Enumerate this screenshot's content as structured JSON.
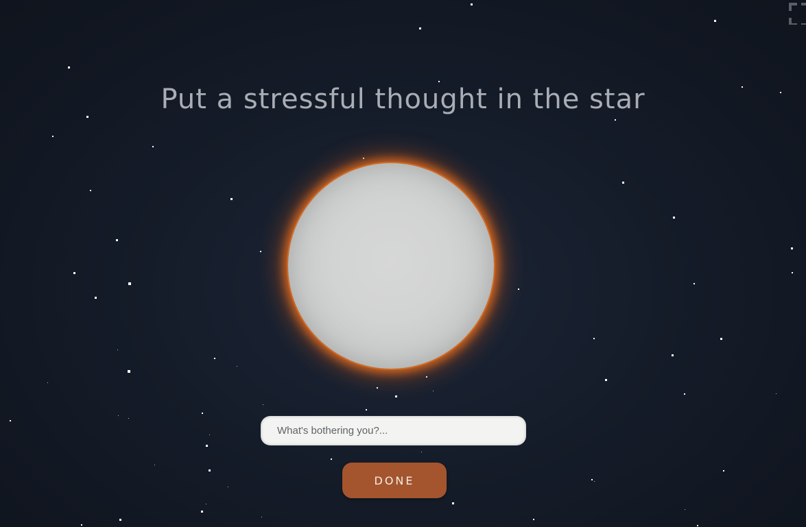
{
  "title": "Put a stressful thought in the star",
  "input": {
    "placeholder": "What's bothering you?..."
  },
  "button": {
    "label": "DONE"
  },
  "icons": {
    "fullscreen": "fullscreen-icon"
  },
  "colors": {
    "star_glow": "#e8702a",
    "star_surface": "#d2d3d3",
    "button": "#a4552d",
    "background": "#151c29"
  }
}
